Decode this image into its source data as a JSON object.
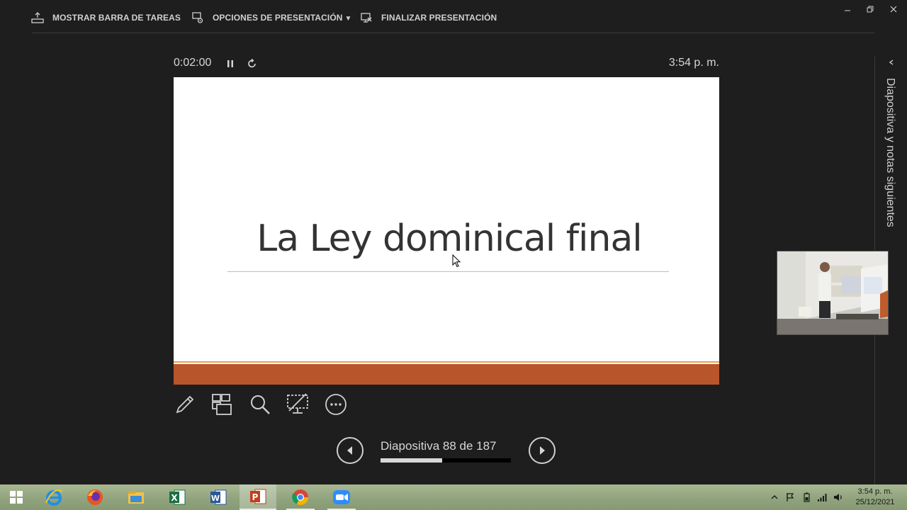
{
  "toolbar": {
    "show_taskbar_label": "MOSTRAR BARRA DE TAREAS",
    "presentation_options_label": "OPCIONES DE PRESENTACIÓN",
    "end_presentation_label": "FINALIZAR PRESENTACIÓN"
  },
  "presenter": {
    "timer": "0:02:00",
    "clock": "3:54 p. m."
  },
  "slide": {
    "title": "La Ley dominical final"
  },
  "navigation": {
    "counter": "Diapositiva 88 de 187",
    "current": 88,
    "total": 187
  },
  "side_panel": {
    "label": "Diapositiva y notas siguientes"
  },
  "taskbar": {
    "apps": [
      "start-icon",
      "internet-explorer-icon",
      "firefox-icon",
      "file-explorer-icon",
      "excel-icon",
      "word-icon",
      "powerpoint-icon",
      "chrome-icon",
      "zoom-icon"
    ],
    "time": "3:54 p. m.",
    "date": "25/12/2021"
  },
  "colors": {
    "background": "#1e1e1e",
    "slide_accent": "#b9552b",
    "slide_accent_thin": "#e8a052"
  }
}
